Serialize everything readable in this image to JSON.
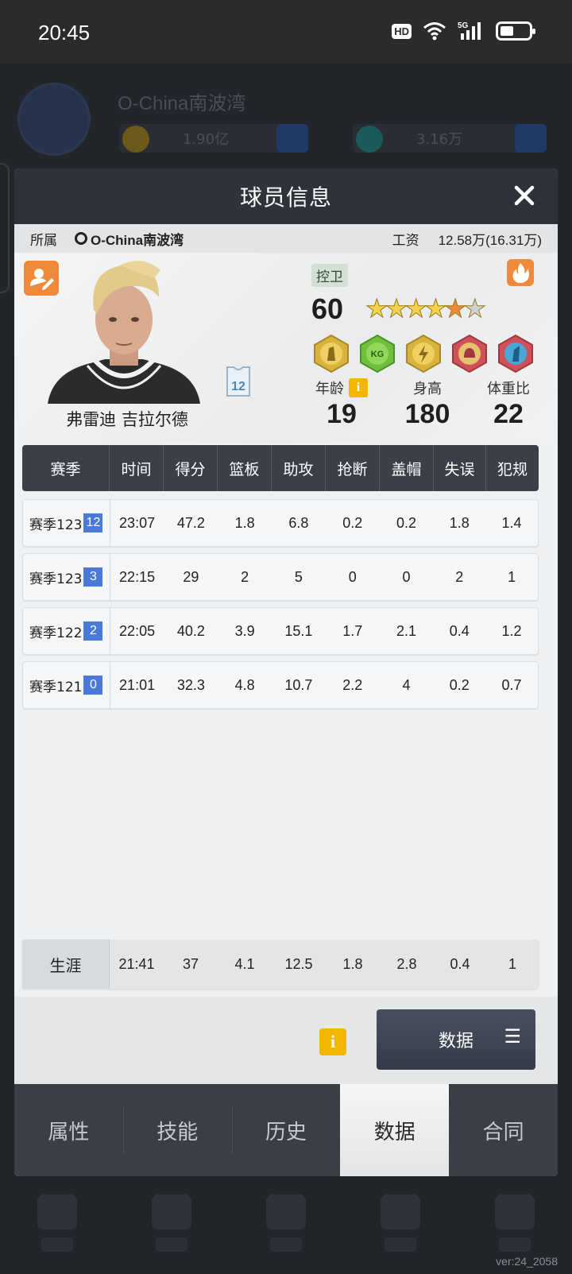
{
  "status_bar": {
    "time": "20:45",
    "hd": "HD",
    "network": "5G"
  },
  "background": {
    "club_name": "O-China南波湾",
    "coins": "1.90亿",
    "gems": "3.16万",
    "version": "ver:24_2058"
  },
  "modal": {
    "title": "球员信息",
    "affiliation_label": "所属",
    "club": "O-China南波湾",
    "salary_label": "工资",
    "salary": "12.58万(16.31万)"
  },
  "player": {
    "name": "弗雷迪 吉拉尔德",
    "jersey_number": "12",
    "position": "控卫",
    "rating": "60",
    "stars": {
      "full": 4,
      "half": 1,
      "empty": 1
    },
    "age_label": "年龄",
    "age": "19",
    "height_label": "身高",
    "height": "180",
    "weight_label": "体重比",
    "weight": "22"
  },
  "colors": {
    "accent_orange": "#f08a3a",
    "info_yellow": "#f2b600",
    "season_blue": "#4a7ad8",
    "header_dark": "#2f3238"
  },
  "table": {
    "headers": [
      "赛季",
      "时间",
      "得分",
      "篮板",
      "助攻",
      "抢断",
      "盖帽",
      "失误",
      "犯规"
    ],
    "rows": [
      {
        "season": "赛季123",
        "index": "12",
        "time": "23:07",
        "pts": "47.2",
        "reb": "1.8",
        "ast": "6.8",
        "stl": "0.2",
        "blk": "0.2",
        "tov": "1.8",
        "pf": "1.4"
      },
      {
        "season": "赛季123",
        "index": "3",
        "time": "22:15",
        "pts": "29",
        "reb": "2",
        "ast": "5",
        "stl": "0",
        "blk": "0",
        "tov": "2",
        "pf": "1"
      },
      {
        "season": "赛季122",
        "index": "2",
        "time": "22:05",
        "pts": "40.2",
        "reb": "3.9",
        "ast": "15.1",
        "stl": "1.7",
        "blk": "2.1",
        "tov": "0.4",
        "pf": "1.2"
      },
      {
        "season": "赛季121",
        "index": "0",
        "time": "21:01",
        "pts": "32.3",
        "reb": "4.8",
        "ast": "10.7",
        "stl": "2.2",
        "blk": "4",
        "tov": "0.2",
        "pf": "0.7"
      }
    ],
    "career": {
      "label": "生涯",
      "time": "21:41",
      "pts": "37",
      "reb": "4.1",
      "ast": "12.5",
      "stl": "1.8",
      "blk": "2.8",
      "tov": "0.4",
      "pf": "1"
    }
  },
  "footer": {
    "data_button": "数据"
  },
  "tabs": [
    "属性",
    "技能",
    "历史",
    "数据",
    "合同"
  ]
}
